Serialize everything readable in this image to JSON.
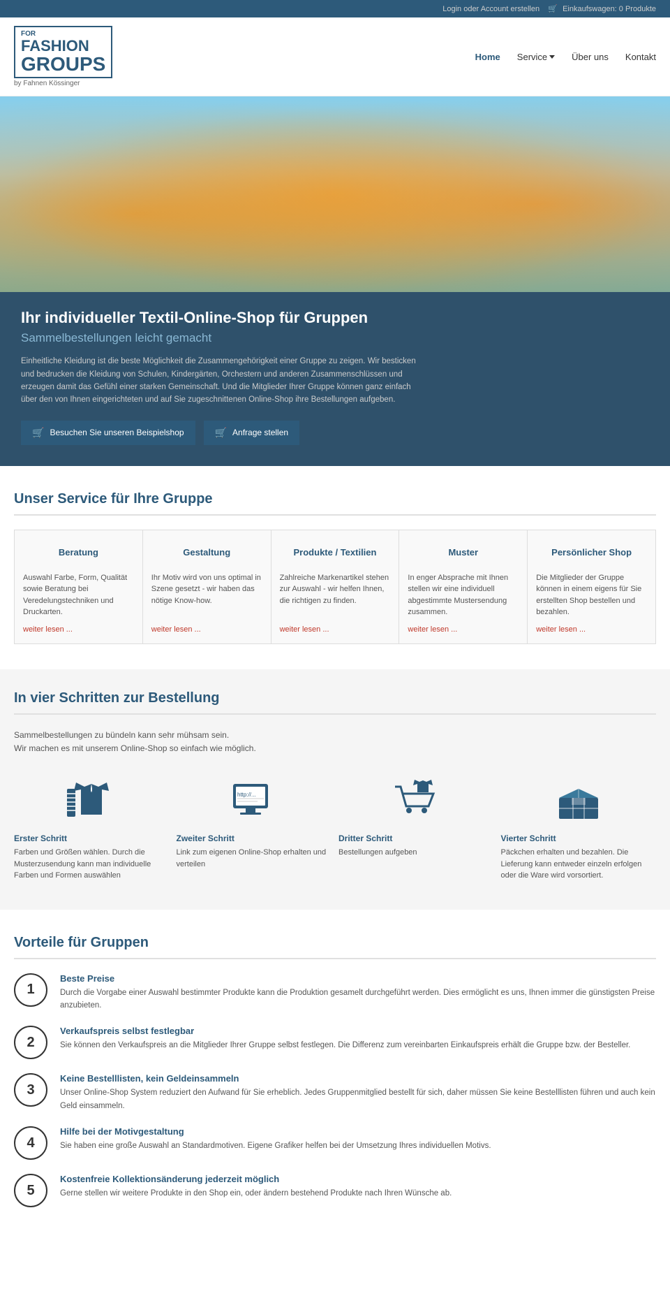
{
  "topbar": {
    "login": "Login",
    "oder": "oder",
    "account": "Account erstellen",
    "cart_icon": "🛒",
    "cart_text": "Einkaufswagen: 0 Produkte"
  },
  "header": {
    "logo_for": "FOR",
    "logo_fashion": "FASHION",
    "logo_groups": "GROUPS",
    "logo_subtitle": "by Fahnen Kössinger",
    "nav": {
      "home": "Home",
      "service": "Service",
      "ueber": "Über uns",
      "kontakt": "Kontakt"
    }
  },
  "hero": {
    "title": "Ihr individueller Textil-Online-Shop für Gruppen",
    "subtitle": "Sammelbestellungen leicht gemacht",
    "body": "Einheitliche Kleidung ist die beste Möglichkeit die Zusammengehörigkeit einer Gruppe zu zeigen. Wir besticken und bedrucken die Kleidung von Schulen, Kindergärten, Orchestern und anderen Zusammenschlüssen und erzeugen damit das Gefühl einer starken Gemeinschaft. Und die Mitglieder Ihrer Gruppe können ganz einfach über den von Ihnen eingerichteten und auf Sie zugeschnittenen Online-Shop ihre Bestellungen aufgeben.",
    "btn1": "Besuchen Sie unseren Beispielshop",
    "btn2": "Anfrage stellen"
  },
  "service_section": {
    "title": "Unser Service für Ihre Gruppe",
    "cards": [
      {
        "title": "Beratung",
        "body": "Auswahl Farbe, Form, Qualität sowie Beratung bei Veredelungstechniken und Druckarten.",
        "link": "weiter lesen ..."
      },
      {
        "title": "Gestaltung",
        "body": "Ihr Motiv wird von uns optimal in Szene gesetzt - wir haben das nötige Know-how.",
        "link": "weiter lesen ..."
      },
      {
        "title": "Produkte / Textilien",
        "body": "Zahlreiche Markenartikel stehen zur Auswahl - wir helfen Ihnen, die richtigen zu finden.",
        "link": "weiter lesen ..."
      },
      {
        "title": "Muster",
        "body": "In enger Absprache mit Ihnen stellen wir eine individuell abgestimmte Mustersendung zusammen.",
        "link": "weiter lesen ..."
      },
      {
        "title": "Persönlicher Shop",
        "body": "Die Mitglieder der Gruppe können in einem eigens für Sie erstellten Shop bestellen und bezahlen.",
        "link": "weiter lesen ..."
      }
    ]
  },
  "steps_section": {
    "title": "In vier Schritten zur Bestellung",
    "subtitle1": "Sammelbestellungen zu bündeln kann sehr mühsam sein.",
    "subtitle2": "Wir machen es mit unserem Online-Shop so einfach wie möglich.",
    "steps": [
      {
        "title": "Erster Schritt",
        "body": "Farben und Größen wählen. Durch die Musterzusendung kann man individuelle Farben und Formen auswählen"
      },
      {
        "title": "Zweiter Schritt",
        "body": "Link zum eigenen Online-Shop erhalten und verteilen"
      },
      {
        "title": "Dritter Schritt",
        "body": "Bestellungen aufgeben"
      },
      {
        "title": "Vierter Schritt",
        "body": "Päckchen erhalten und bezahlen. Die Lieferung kann entweder einzeln erfolgen oder die Ware wird vorsortiert."
      }
    ]
  },
  "vorteile_section": {
    "title": "Vorteile für Gruppen",
    "items": [
      {
        "number": "1",
        "title": "Beste Preise",
        "body": "Durch die Vorgabe einer Auswahl bestimmter Produkte kann die Produktion gesamelt durchgeführt werden. Dies ermöglicht es uns, Ihnen immer die günstigsten Preise anzubieten."
      },
      {
        "number": "2",
        "title": "Verkaufspreis selbst festlegbar",
        "body": "Sie können den Verkaufspreis an die Mitglieder Ihrer Gruppe selbst festlegen. Die Differenz zum vereinbarten Einkaufspreis erhält die Gruppe bzw. der Besteller."
      },
      {
        "number": "3",
        "title": "Keine Bestelllisten, kein Geldeinsammeln",
        "body": "Unser Online-Shop System reduziert den Aufwand für Sie erheblich. Jedes Gruppenmitglied bestellt für sich, daher müssen Sie keine Bestelllisten führen und auch kein Geld einsammeln."
      },
      {
        "number": "4",
        "title": "Hilfe bei der Motivgestaltung",
        "body": "Sie haben eine große Auswahl an Standardmotiven. Eigene Grafiker helfen bei der Umsetzung Ihres individuellen Motivs."
      },
      {
        "number": "5",
        "title": "Kostenfreie Kollektionsänderung jederzeit möglich",
        "body": "Gerne stellen wir weitere Produkte in den Shop ein, oder ändern bestehend Produkte nach Ihren Wünsche ab."
      }
    ]
  }
}
